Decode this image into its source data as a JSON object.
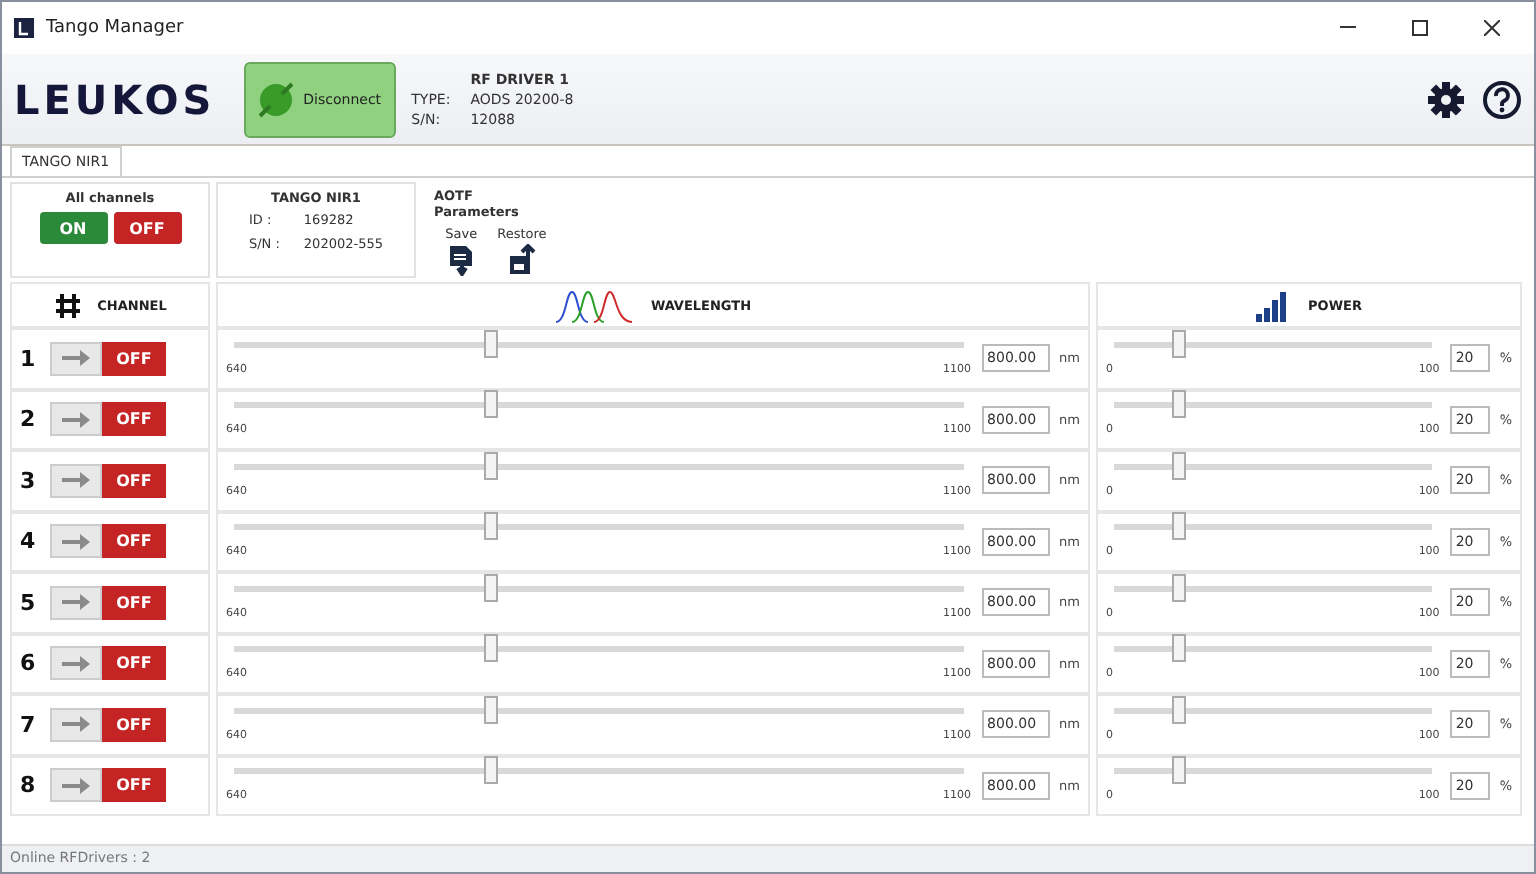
{
  "window": {
    "title": "Tango Manager"
  },
  "header": {
    "logo": "LEUKOS",
    "connect_button": "Disconnect",
    "connected": true,
    "driver_title": "RF DRIVER 1",
    "type_label": "TYPE:",
    "type_value": "AODS 20200-8",
    "sn_label": "S/N:",
    "sn_value": "12088"
  },
  "tabs": [
    {
      "label": "TANGO NIR1",
      "selected": true
    }
  ],
  "all_channels": {
    "title": "All channels",
    "on_label": "ON",
    "off_label": "OFF"
  },
  "device": {
    "title": "TANGO NIR1",
    "id_label": "ID :",
    "id_value": "169282",
    "sn_label": "S/N :",
    "sn_value": "202002-555"
  },
  "aotf": {
    "title": "AOTF Parameters",
    "save_label": "Save",
    "restore_label": "Restore"
  },
  "columns": {
    "channel": "CHANNEL",
    "wavelength": "WAVELENGTH",
    "power": "POWER"
  },
  "channels": [
    {
      "number": "1",
      "on": false,
      "state_label": "OFF",
      "wavelength": {
        "level": 0.35,
        "min": "640",
        "max": "1100",
        "value": "800.00",
        "unit": "nm"
      },
      "power": {
        "level": 0.2,
        "min": "0",
        "max": "100",
        "value": "20",
        "unit": "%"
      }
    },
    {
      "number": "2",
      "on": false,
      "state_label": "OFF",
      "wavelength": {
        "level": 0.35,
        "min": "640",
        "max": "1100",
        "value": "800.00",
        "unit": "nm"
      },
      "power": {
        "level": 0.2,
        "min": "0",
        "max": "100",
        "value": "20",
        "unit": "%"
      }
    },
    {
      "number": "3",
      "on": false,
      "state_label": "OFF",
      "wavelength": {
        "level": 0.35,
        "min": "640",
        "max": "1100",
        "value": "800.00",
        "unit": "nm"
      },
      "power": {
        "level": 0.2,
        "min": "0",
        "max": "100",
        "value": "20",
        "unit": "%"
      }
    },
    {
      "number": "4",
      "on": false,
      "state_label": "OFF",
      "wavelength": {
        "level": 0.35,
        "min": "640",
        "max": "1100",
        "value": "800.00",
        "unit": "nm"
      },
      "power": {
        "level": 0.2,
        "min": "0",
        "max": "100",
        "value": "20",
        "unit": "%"
      }
    },
    {
      "number": "5",
      "on": false,
      "state_label": "OFF",
      "wavelength": {
        "level": 0.35,
        "min": "640",
        "max": "1100",
        "value": "800.00",
        "unit": "nm"
      },
      "power": {
        "level": 0.2,
        "min": "0",
        "max": "100",
        "value": "20",
        "unit": "%"
      }
    },
    {
      "number": "6",
      "on": false,
      "state_label": "OFF",
      "wavelength": {
        "level": 0.35,
        "min": "640",
        "max": "1100",
        "value": "800.00",
        "unit": "nm"
      },
      "power": {
        "level": 0.2,
        "min": "0",
        "max": "100",
        "value": "20",
        "unit": "%"
      }
    },
    {
      "number": "7",
      "on": false,
      "state_label": "OFF",
      "wavelength": {
        "level": 0.35,
        "min": "640",
        "max": "1100",
        "value": "800.00",
        "unit": "nm"
      },
      "power": {
        "level": 0.2,
        "min": "0",
        "max": "100",
        "value": "20",
        "unit": "%"
      }
    },
    {
      "number": "8",
      "on": false,
      "state_label": "OFF",
      "wavelength": {
        "level": 0.35,
        "min": "640",
        "max": "1100",
        "value": "800.00",
        "unit": "nm"
      },
      "power": {
        "level": 0.2,
        "min": "0",
        "max": "100",
        "value": "20",
        "unit": "%"
      }
    }
  ],
  "status_bar": "Online RFDrivers : 2"
}
